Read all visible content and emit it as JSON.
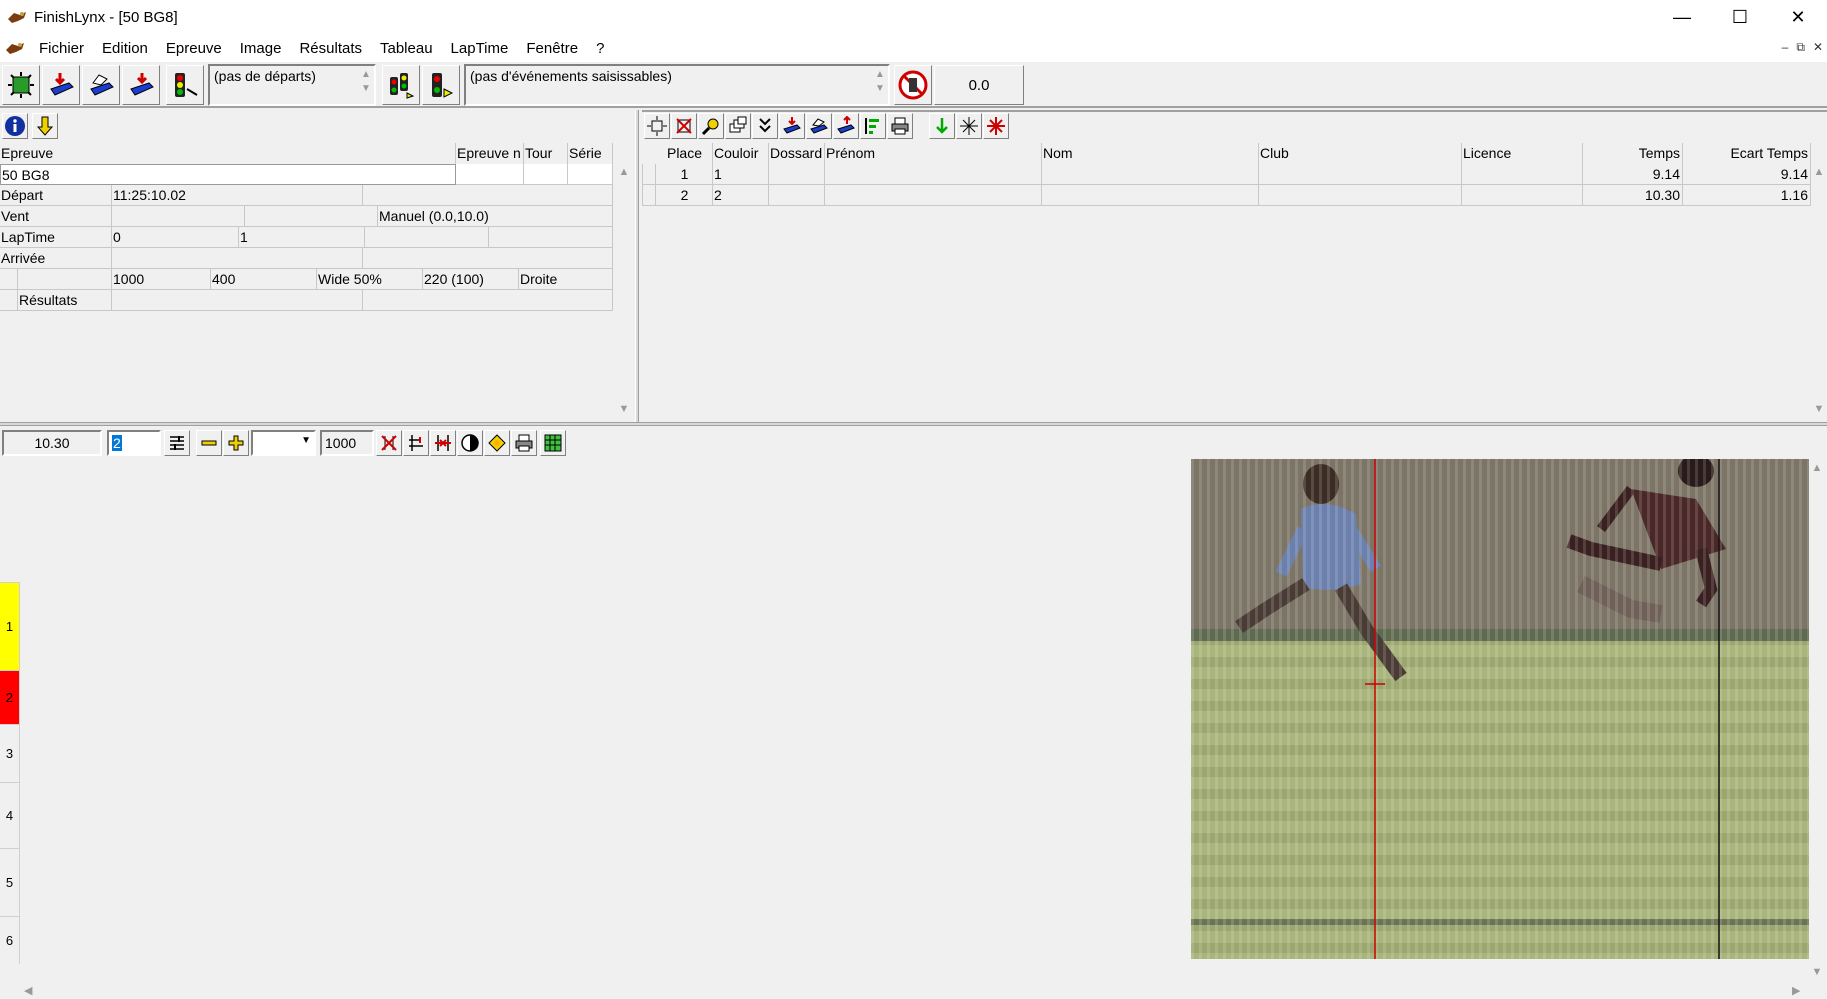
{
  "window": {
    "title": "FinishLynx - [50 BG8]",
    "minimize": "—",
    "maximize": "☐",
    "close": "✕"
  },
  "menu": {
    "items": [
      "Fichier",
      "Edition",
      "Epreuve",
      "Image",
      "Résultats",
      "Tableau",
      "LapTime",
      "Fenêtre",
      "?"
    ],
    "mdi_min": "–",
    "mdi_restore": "⧉",
    "mdi_close": "✕"
  },
  "toolbar": {
    "starts_combo": "(pas de départs)",
    "events_combo": "(pas d'événements saisissables)",
    "time_display": "0.0"
  },
  "event_info": {
    "headers": [
      "Epreuve",
      "Epreuve n",
      "Tour",
      "Série"
    ],
    "event_name": "50 BG8",
    "rows": [
      {
        "label": "Départ",
        "v1": "11:25:10.02",
        "v2": "",
        "v3": ""
      },
      {
        "label": "Vent",
        "v1": "",
        "v2": "",
        "v3": "Manuel (0.0,10.0)"
      },
      {
        "label": "LapTime",
        "v1": "0",
        "v2": "1",
        "v3": ""
      },
      {
        "label": "Arrivée",
        "v1": "",
        "v2": "",
        "v3": ""
      }
    ],
    "settings_row": [
      "1000",
      "400",
      "Wide 50%",
      "220  (100)",
      "Droite"
    ],
    "results_label": "Résultats"
  },
  "results": {
    "headers": [
      "Place",
      "Couloir",
      "Dossard",
      "Prénom",
      "Nom",
      "Club",
      "Licence",
      "Temps",
      "Ecart Temps"
    ],
    "rows": [
      {
        "place": "1",
        "lane": "1",
        "bib": "",
        "first": "",
        "last": "",
        "club": "",
        "license": "",
        "time": "9.14",
        "gap": "9.14"
      },
      {
        "place": "2",
        "lane": "2",
        "bib": "",
        "first": "",
        "last": "",
        "club": "",
        "license": "",
        "time": "10.30",
        "gap": "1.16"
      }
    ]
  },
  "image_toolbar": {
    "cursor_time": "10.30",
    "lane_input": "2",
    "density_input": "1000"
  },
  "lanes": {
    "labels": [
      "1",
      "2",
      "3",
      "4",
      "5",
      "6"
    ],
    "lane1_color": "#ffff00",
    "lane2_color": "#ff0000"
  },
  "colors": {
    "accent_red": "#cc0000",
    "track_green": "#a9b57a"
  }
}
